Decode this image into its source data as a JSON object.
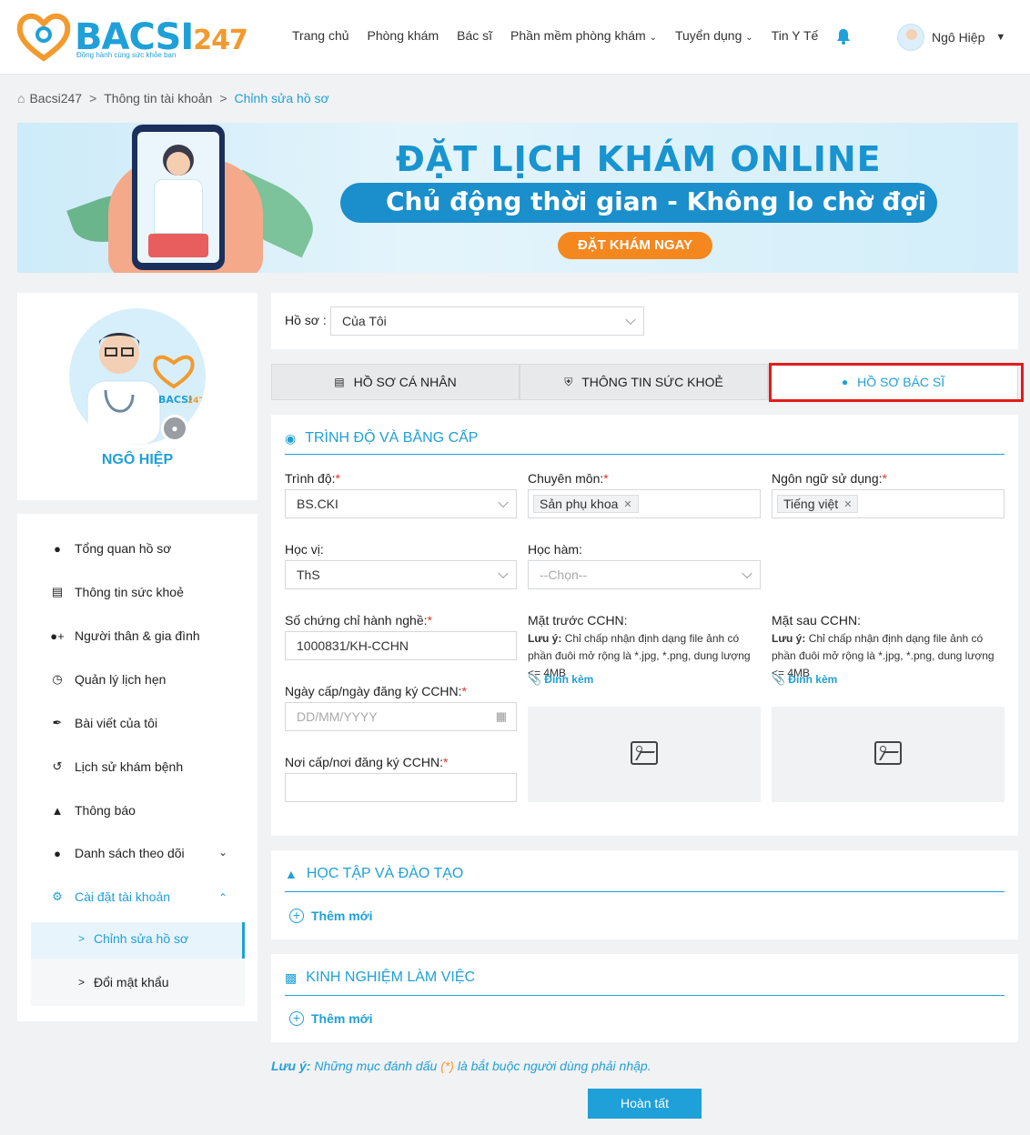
{
  "header": {
    "logo_text": "BACSI",
    "logo_num": "247",
    "logo_tagline": "Đồng hành cùng sức khỏe bạn",
    "nav": [
      "Trang chủ",
      "Phòng khám",
      "Bác sĩ",
      "Phần mềm phòng khám",
      "Tuyển dụng",
      "Tin Y Tế"
    ],
    "user_name": "Ngô Hiệp"
  },
  "breadcrumb": {
    "home": "Bacsi247",
    "level1": "Thông tin tài khoản",
    "current": "Chỉnh sửa hồ sơ",
    "sep": ">"
  },
  "banner": {
    "title": "ĐẶT LỊCH KHÁM ONLINE",
    "subtitle": "Chủ động thời gian - Không lo chờ đợi",
    "button": "ĐẶT KHÁM NGAY"
  },
  "profile": {
    "name": "NGÔ HIỆP"
  },
  "menu": {
    "items": [
      "Tổng quan hồ sơ",
      "Thông tin sức khoẻ",
      "Người thân & gia đình",
      "Quản lý lịch hẹn",
      "Bài viết của tôi",
      "Lịch sử khám bệnh",
      "Thông báo",
      "Danh sách theo dõi",
      "Cài đặt tài khoản"
    ],
    "sub_items": [
      "Chỉnh sửa hồ sơ",
      "Đổi mật khẩu"
    ]
  },
  "hoso": {
    "label": "Hồ sơ :",
    "value": "Của Tôi"
  },
  "tabs": [
    "HỒ SƠ CÁ NHÂN",
    "THÔNG TIN SỨC KHOẺ",
    "HỒ SƠ BÁC SĨ"
  ],
  "form": {
    "section_title": "TRÌNH ĐỘ VÀ BẰNG CẤP",
    "trinh_do_label": "Trình độ:",
    "trinh_do_value": "BS.CKI",
    "chuyen_mon_label": "Chuyên môn:",
    "chuyen_mon_tag": "Sản phụ khoa",
    "ngon_ngu_label": "Ngôn ngữ sử dụng:",
    "ngon_ngu_tag": "Tiếng việt",
    "hoc_vi_label": "Học vị:",
    "hoc_vi_value": "ThS",
    "hoc_ham_label": "Học hàm:",
    "hoc_ham_value": "--Chọn--",
    "so_cc_label": "Số chứng chỉ hành nghề:",
    "so_cc_value": "1000831/KH-CCHN",
    "mat_truoc_label": "Mặt trước CCHN:",
    "mat_sau_label": "Mặt sau CCHN:",
    "note_prefix": "Lưu ý:",
    "note_text": "Chỉ chấp nhận định dạng file ảnh có phần đuôi mở rộng là *.jpg, *.png, dung lượng <= 4MB",
    "attach": "Đính kèm",
    "ngay_cap_label": "Ngày cấp/ngày đăng ký CCHN:",
    "ngay_cap_placeholder": "DD/MM/YYYY",
    "noi_cap_label": "Nơi cấp/nơi đăng ký CCHN:",
    "required_mark": "*"
  },
  "hoc_tap": {
    "title": "HỌC TẬP VÀ ĐÀO TẠO",
    "add": "Thêm mới"
  },
  "kinh_nghiem": {
    "title": "KINH NGHIỆM LÀM VIỆC",
    "add": "Thêm mới"
  },
  "footer": {
    "note_prefix": "Lưu ý:",
    "note_mid": " Những mục đánh dấu ",
    "note_star": "(*)",
    "note_end": " là bắt buộc người dùng phải nhập.",
    "submit": "Hoàn tất"
  },
  "colors": {
    "primary": "#1fa0d8",
    "accent": "#f29a2e",
    "required": "#e0342b",
    "highlight": "#e31b1b"
  }
}
